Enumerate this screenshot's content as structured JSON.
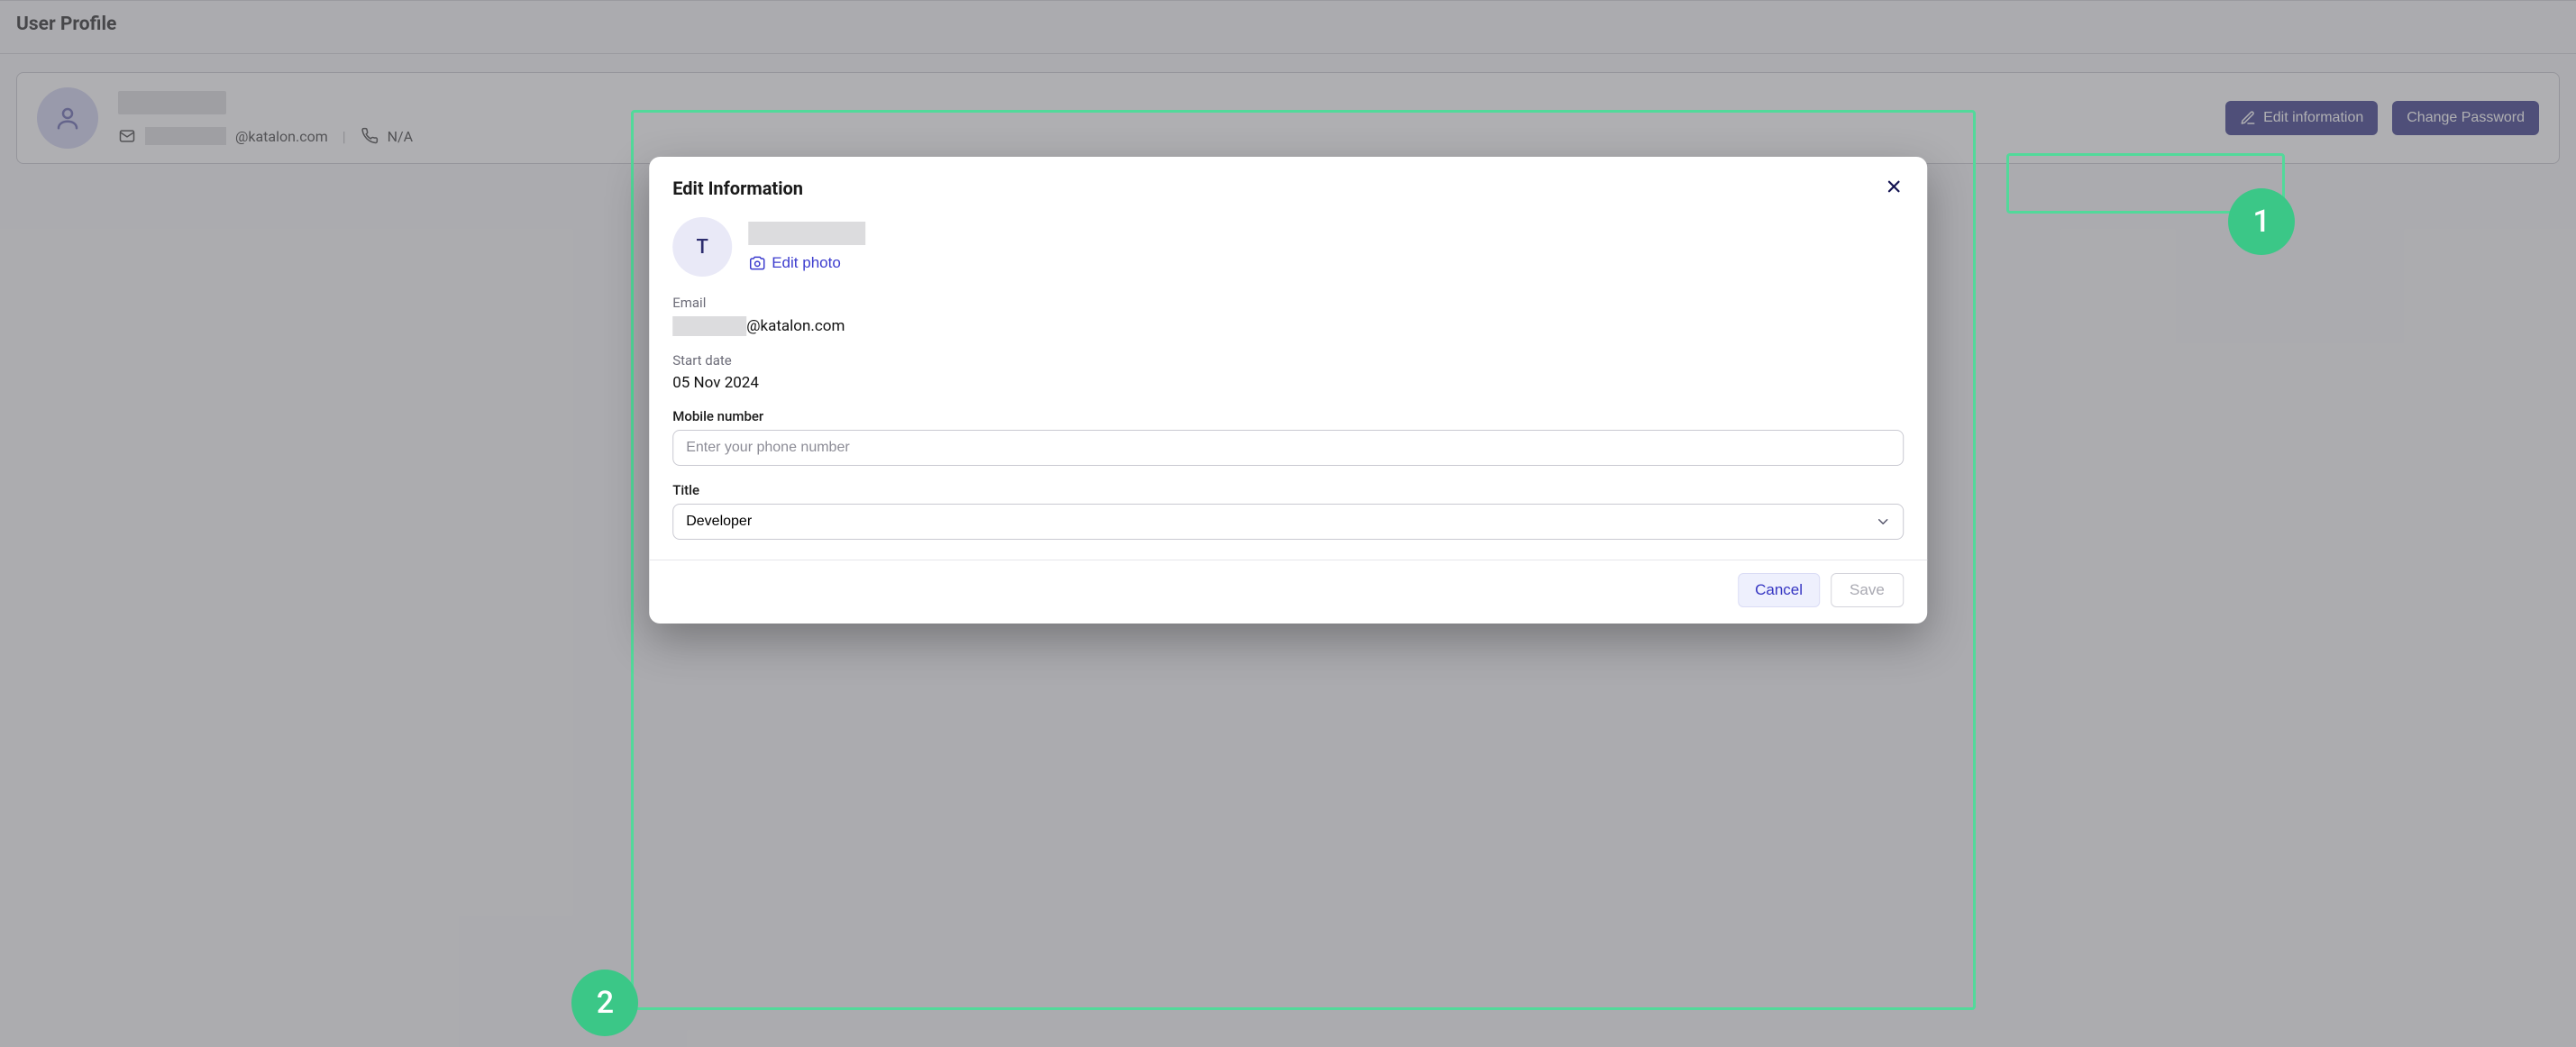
{
  "page": {
    "title": "User Profile",
    "edit_info_btn": "Edit information",
    "change_pw_btn": "Change Password",
    "email_domain": "@katalon.com",
    "phone_value": "N/A"
  },
  "annotations": {
    "badge1": "1",
    "badge2": "2"
  },
  "modal": {
    "title": "Edit Information",
    "avatar_initial": "T",
    "edit_photo": "Edit photo",
    "email_label": "Email",
    "email_domain": "@katalon.com",
    "start_label": "Start date",
    "start_value": "05 Nov 2024",
    "mobile_label": "Mobile number",
    "mobile_placeholder": "Enter your phone number",
    "title_label": "Title",
    "title_value": "Developer",
    "cancel": "Cancel",
    "save": "Save"
  }
}
